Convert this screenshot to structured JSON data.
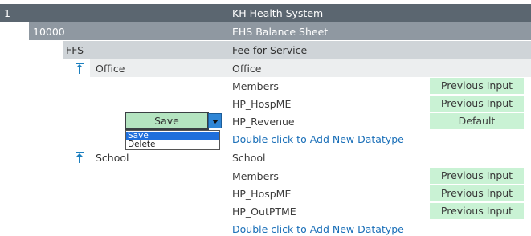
{
  "hierarchy": {
    "level1": {
      "code": "1",
      "name": "KH Health System"
    },
    "level2": {
      "code": "10000",
      "name": "EHS Balance Sheet"
    },
    "level3": {
      "code": "FFS",
      "name": "Fee for Service"
    }
  },
  "groups": [
    {
      "label": "Office",
      "title": "Office",
      "rows": [
        {
          "name": "Members",
          "value": "Previous Input"
        },
        {
          "name": "HP_HospME",
          "value": "Previous Input"
        },
        {
          "name": "HP_Revenue",
          "value": "Default"
        }
      ],
      "add_link": "Double click to Add New Datatype"
    },
    {
      "label": "School",
      "title": "School",
      "rows": [
        {
          "name": "Members",
          "value": "Previous Input"
        },
        {
          "name": "HP_HospME",
          "value": "Previous Input"
        },
        {
          "name": "HP_OutPTME",
          "value": "Previous Input"
        }
      ],
      "add_link": "Double click to Add New Datatype"
    }
  ],
  "action_dropdown": {
    "selected": "Save",
    "options": [
      "Save",
      "Delete"
    ]
  },
  "colors": {
    "level1_bg": "#5b6670",
    "level2_bg": "#8f98a1",
    "level3_bg": "#cfd4d8",
    "level4_bg": "#eceeef",
    "value_pill_bg": "#c9f2d4",
    "link": "#1a6fb8",
    "accent_icon": "#1b7fbf",
    "selected_option": "#1e6fdc"
  },
  "icons": {
    "group_toggle": "pin-top-icon",
    "dropdown": "chevron-down-icon"
  }
}
